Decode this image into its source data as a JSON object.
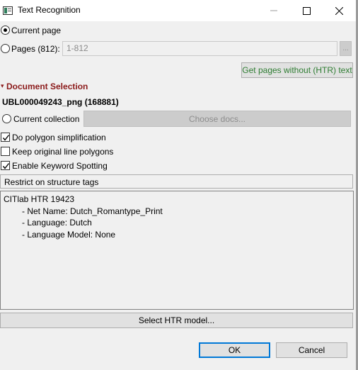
{
  "window": {
    "title": "Text Recognition",
    "controls": {
      "minimize": "—",
      "maximize": "☐",
      "close": "✕"
    }
  },
  "page_selection": {
    "current_page_label": "Current page",
    "pages_label": "Pages (812):",
    "pages_value": "1-812",
    "pages_browse_label": "...",
    "get_pages_button": "Get pages without (HTR) text"
  },
  "document_selection": {
    "header": "Document Selection",
    "document_name": "UBL000049243_png (168881)",
    "current_collection_label": "Current collection",
    "choose_docs_button": "Choose docs..."
  },
  "options": {
    "polygon_simplification": {
      "label": "Do polygon simplification",
      "checked": true
    },
    "keep_original_polygons": {
      "label": "Keep original line polygons",
      "checked": false
    },
    "keyword_spotting": {
      "label": "Enable Keyword Spotting",
      "checked": true
    }
  },
  "restrict_tags_label": "Restrict on structure tags",
  "model_info": {
    "title": "CITlab HTR 19423",
    "lines": [
      "- Net Name: Dutch_Romantype_Print",
      "- Language: Dutch",
      "- Language Model: None"
    ]
  },
  "select_model_button": "Select HTR model...",
  "footer": {
    "ok_label": "OK",
    "cancel_label": "Cancel"
  },
  "colors": {
    "section_header": "#8b1a1a",
    "get_pages_text": "#2e7d32",
    "default_focus": "#0078d7"
  }
}
